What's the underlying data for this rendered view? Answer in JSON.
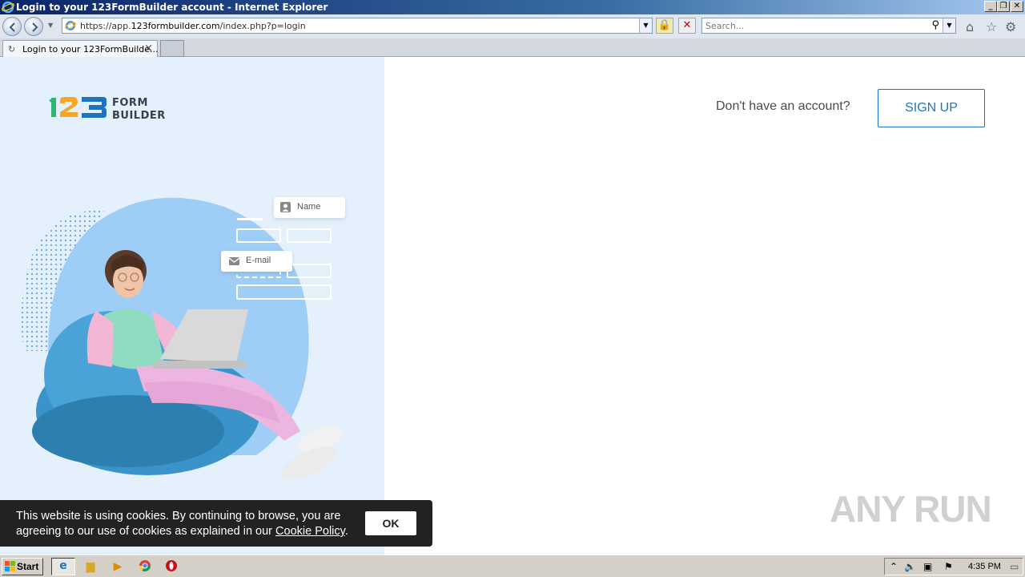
{
  "window": {
    "title": "Login to your 123FormBuilder account - Internet Explorer"
  },
  "browser": {
    "url_prefix": "https://app.",
    "url_domain": "123formbuilder.com",
    "url_path": "/index.php?p=login",
    "search_placeholder": "Search...",
    "tab_label": "Login to your 123FormBuilde...",
    "tab_close": "×"
  },
  "logo": {
    "digits": "123",
    "line1": "FORM",
    "line2": "BUILDER",
    "colors": [
      "#2bb673",
      "#f6a623",
      "#1e73be"
    ]
  },
  "header": {
    "no_account_text": "Don't have an account?",
    "signup_label": "SIGN UP"
  },
  "illustration": {
    "name_field": "Name",
    "email_field": "E-mail"
  },
  "cookie": {
    "text_before": "This website is using cookies. By continuing to browse, you are agreeing to our use of cookies as explained in our ",
    "link": "Cookie Policy",
    "text_after": ".",
    "ok_label": "OK"
  },
  "watermark": "ANY RUN",
  "taskbar": {
    "start_label": "Start",
    "time": "4:35 PM"
  }
}
